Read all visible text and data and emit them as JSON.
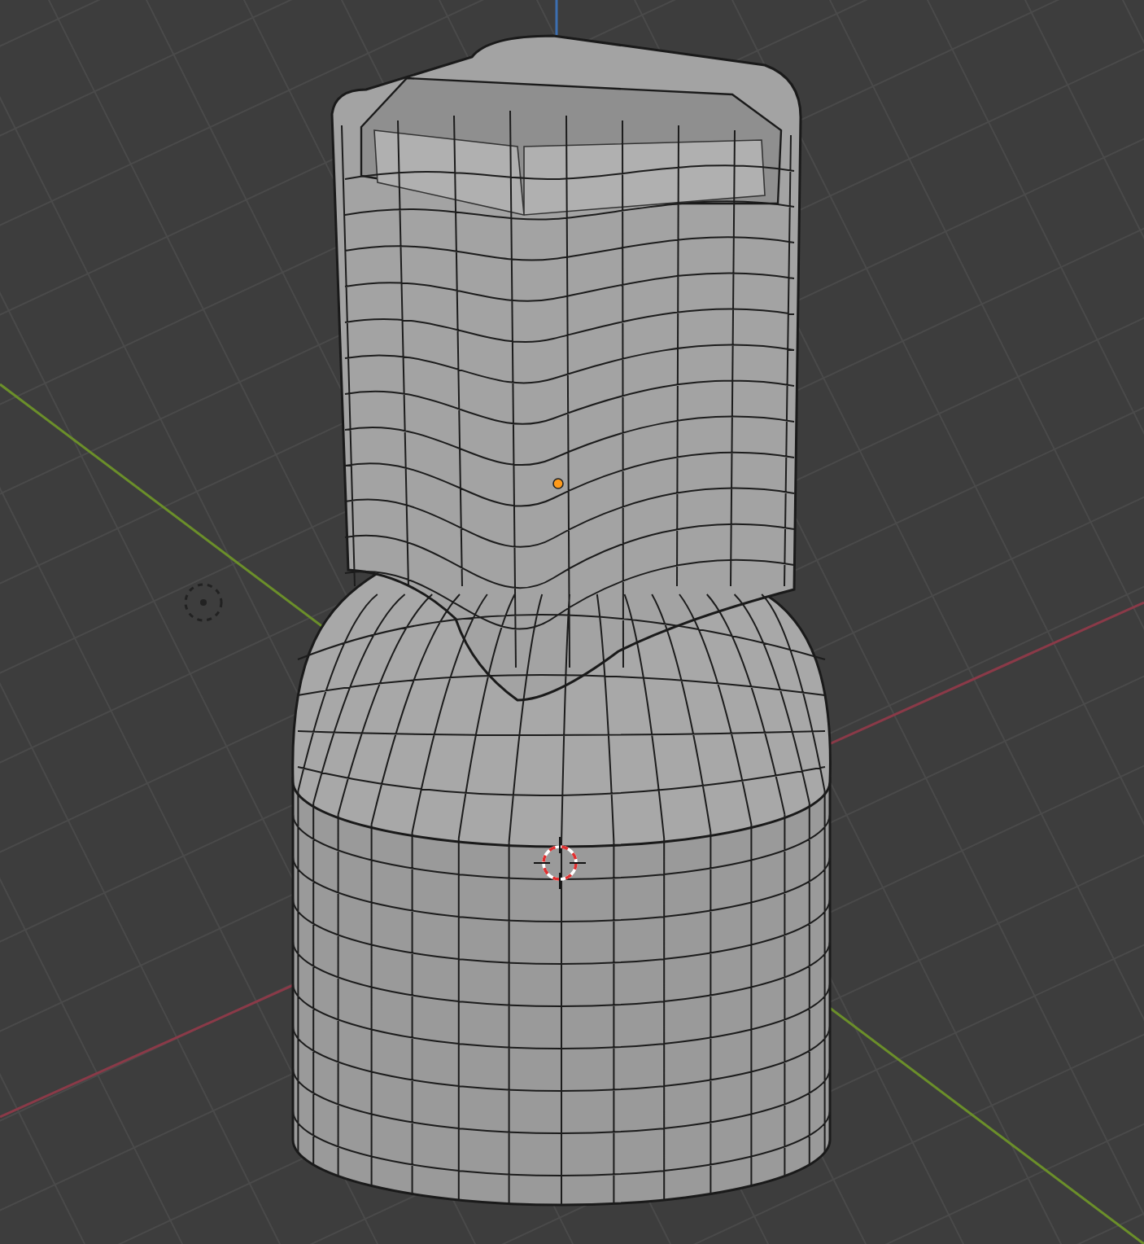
{
  "viewport": {
    "kind": "perspective"
  }
}
